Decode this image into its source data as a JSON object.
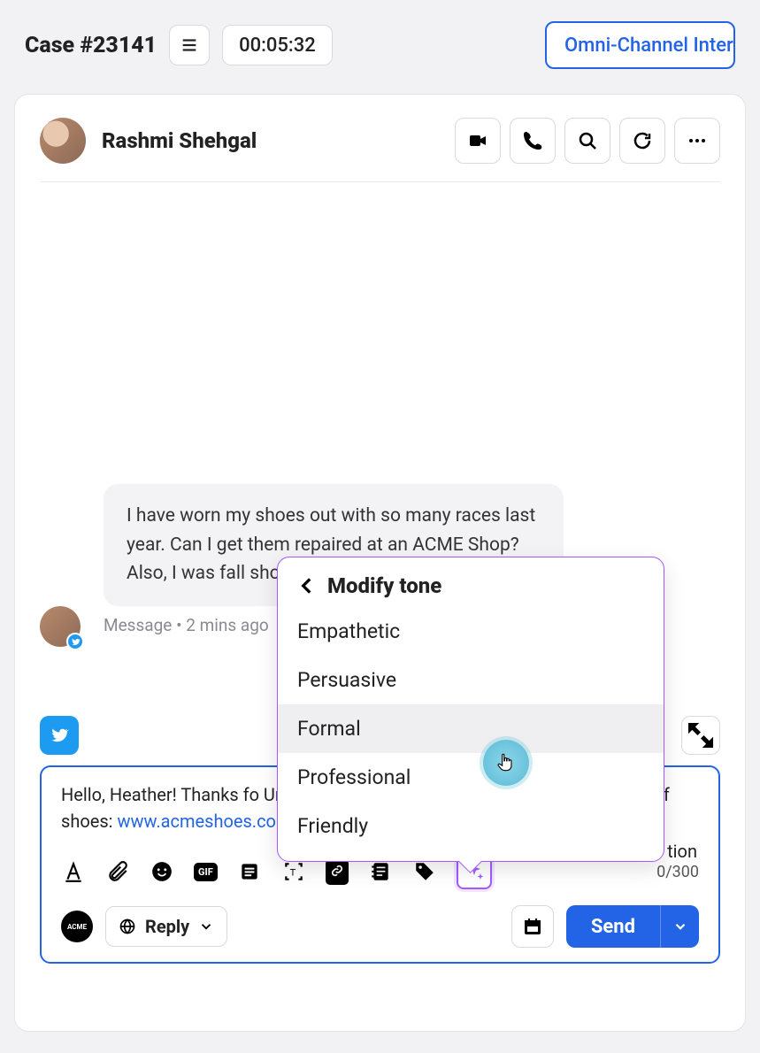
{
  "header": {
    "case_label": "Case #23141",
    "timer": "00:05:32",
    "omni_label": "Omni-Channel Intera"
  },
  "contact": {
    "name": "Rashmi Shehgal"
  },
  "message": {
    "text": "I have worn my shoes out with so many races last year. Can I get them repaired at an ACME Shop? Also, I was fall shoe collection share the link?",
    "meta": "Message • 2 mins ago"
  },
  "compose": {
    "text_before_link": "Hello, Heather! Thanks fo Unfortunately, we can't p give you a discount on a of shoes: ",
    "link_text": "www.acmeshoes.com/fallcollection.",
    "text_tail": "tion",
    "char_count": "0/300",
    "reply_label": "Reply",
    "send_label": "Send",
    "brand": "ACME"
  },
  "popover": {
    "title": "Modify tone",
    "items": [
      "Empathetic",
      "Persuasive",
      "Formal",
      "Professional",
      "Friendly"
    ],
    "hover_index": 2
  }
}
